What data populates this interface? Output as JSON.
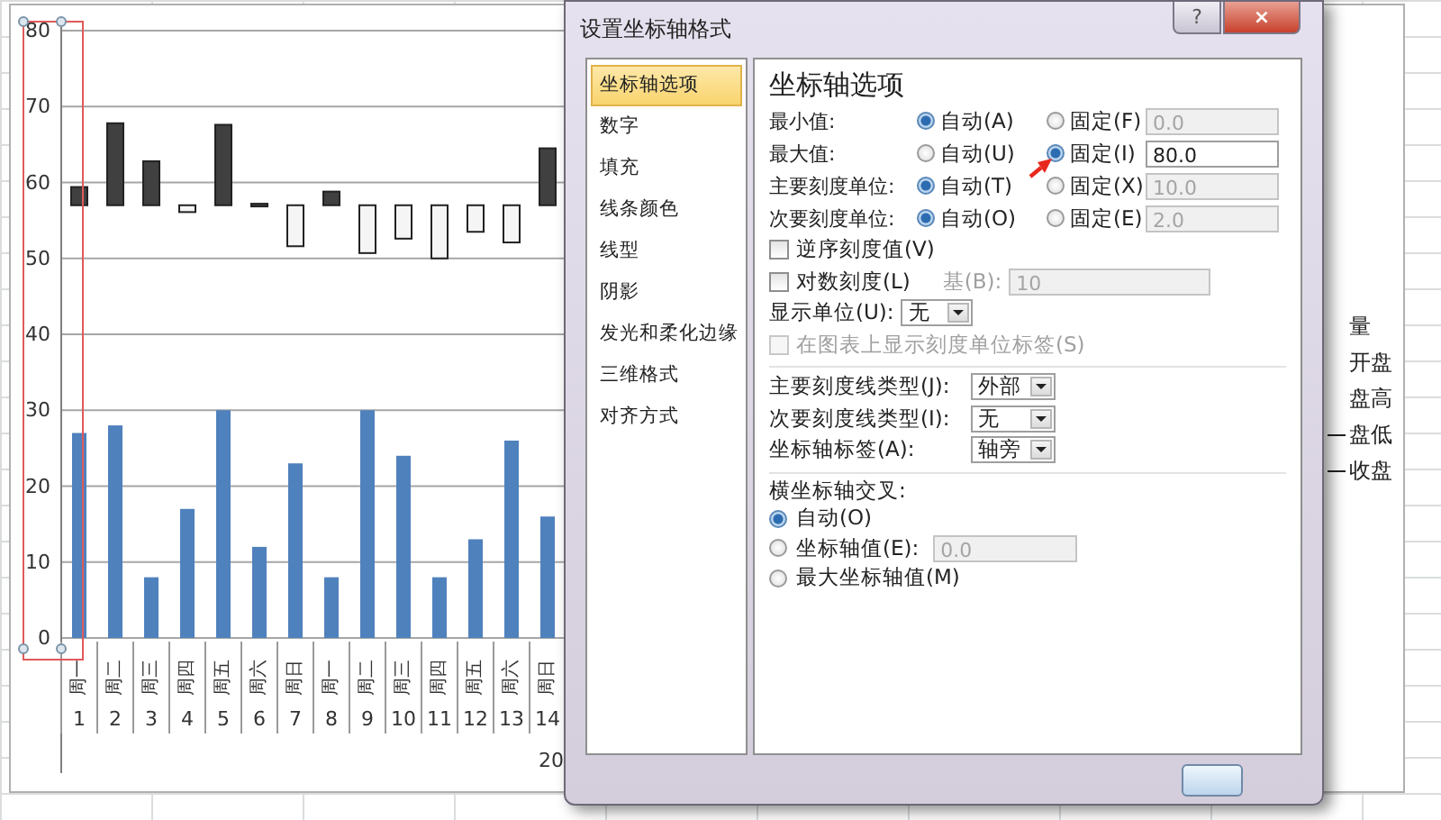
{
  "chart": {
    "y_labels": [
      "80",
      "70",
      "60",
      "50",
      "40",
      "30",
      "20",
      "10",
      "0"
    ],
    "chart_data": {
      "type": "bar",
      "grid": true,
      "categories": [
        "周一",
        "周二",
        "周三",
        "周四",
        "周五",
        "周六",
        "周日",
        "周一",
        "周二",
        "周三",
        "周四",
        "周五",
        "周六",
        "周日"
      ],
      "ylim": [
        0,
        80
      ],
      "yticks": [
        0,
        10,
        20,
        30,
        40,
        50,
        60,
        70,
        80
      ],
      "series": [
        {
          "name": "量",
          "color": "#4f81bd",
          "values": [
            27,
            28,
            8,
            17,
            30,
            12,
            23,
            8,
            30,
            24,
            8,
            13,
            26,
            16
          ]
        }
      ]
    },
    "day_numbers": [
      "1",
      "2",
      "3",
      "4",
      "5",
      "6",
      "7",
      "8",
      "9",
      "10",
      "11",
      "12",
      "13",
      "14"
    ],
    "group_label": "20",
    "legend": [
      {
        "label": "开盘",
        "marker": false
      },
      {
        "label": "盘高",
        "marker": false
      },
      {
        "label": "盘低",
        "marker": true
      },
      {
        "label": "收盘",
        "marker": true
      }
    ]
  },
  "dialog": {
    "title": "设置坐标轴格式",
    "title_buttons": [
      "?",
      "×"
    ],
    "categories": [
      {
        "label": "坐标轴选项",
        "selected": true
      },
      {
        "label": "数字",
        "selected": false
      },
      {
        "label": "填充",
        "selected": false
      },
      {
        "label": "线条颜色",
        "selected": false
      },
      {
        "label": "线型",
        "selected": false
      },
      {
        "label": "阴影",
        "selected": false
      },
      {
        "label": "发光和柔化边缘",
        "selected": false
      },
      {
        "label": "三维格式",
        "selected": false
      },
      {
        "label": "对齐方式",
        "selected": false
      }
    ],
    "heading": "坐标轴选项",
    "bounds": [
      {
        "label": "最小值:",
        "options": [
          {
            "label": "自动(A)",
            "selected": true
          },
          {
            "label": "固定(F)",
            "selected": false
          }
        ],
        "value": "0.0",
        "value_disabled": true
      },
      {
        "label": "最大值:",
        "options": [
          {
            "label": "自动(U)",
            "selected": false
          },
          {
            "label": "固定(I)",
            "selected": true
          }
        ],
        "value": "80.0",
        "value_disabled": false
      },
      {
        "label": "主要刻度单位:",
        "options": [
          {
            "label": "自动(T)",
            "selected": true
          },
          {
            "label": "固定(X)",
            "selected": false
          }
        ],
        "value": "10.0",
        "value_disabled": true
      },
      {
        "label": "次要刻度单位:",
        "options": [
          {
            "label": "自动(O)",
            "selected": true
          },
          {
            "label": "固定(E)",
            "selected": false
          }
        ],
        "value": "2.0",
        "value_disabled": true
      }
    ],
    "reverse": {
      "label": "逆序刻度值(V)",
      "checked": false
    },
    "log_scale": {
      "label": "对数刻度(L)",
      "checked": false,
      "base_label": "基(B):",
      "base_value": "10",
      "base_disabled": true
    },
    "display_unit": {
      "label": "显示单位(U):",
      "value": "无"
    },
    "show_unit_label": {
      "label": "在图表上显示刻度单位标签(S)",
      "checked": false,
      "disabled": true
    },
    "dropdowns": [
      {
        "label": "主要刻度线类型(J):",
        "value": "外部"
      },
      {
        "label": "次要刻度线类型(I):",
        "value": "无"
      },
      {
        "label": "坐标轴标签(A):",
        "value": "轴旁"
      }
    ],
    "crossing": {
      "label": "横坐标轴交叉:",
      "options": [
        {
          "label": "自动(O)",
          "selected": true
        },
        {
          "label": "坐标轴值(E):",
          "selected": false,
          "value": "0.0",
          "value_disabled": true
        },
        {
          "label": "最大坐标轴值(M)",
          "selected": false
        }
      ]
    }
  }
}
